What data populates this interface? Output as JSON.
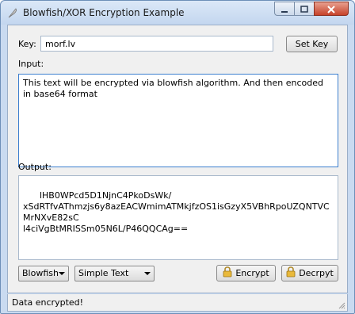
{
  "window": {
    "title": "Blowfish/XOR Encryption Example",
    "icons": {
      "app": "feather-icon",
      "minimize": "minimize-icon",
      "maximize": "maximize-icon",
      "close": "close-icon"
    }
  },
  "key": {
    "label": "Key:",
    "value": "morf.lv",
    "button_label": "Set Key"
  },
  "input": {
    "label": "Input:",
    "text": "This text will be encrypted via blowfish algorithm. And then encoded in base64 format"
  },
  "output": {
    "label": "Output:",
    "text": "lHB0WPcd5D1NjnC4PkoDsWk/\nxSdRTfvAThmzjs6y8azEACWmimATMkjfzOS1isGzyX5VBhRpoUZQNTVCMrNXvE82sC\nl4ciVgBtMRISSm05N6L/P46QQCAg=="
  },
  "controls": {
    "algorithm": {
      "selected": "Blowfish"
    },
    "format": {
      "selected": "Simple Text"
    },
    "encrypt_label": "Encrypt",
    "decrypt_label": "Decrpyt",
    "lock_icon": "lock-icon"
  },
  "status": {
    "text": "Data encrypted!"
  }
}
